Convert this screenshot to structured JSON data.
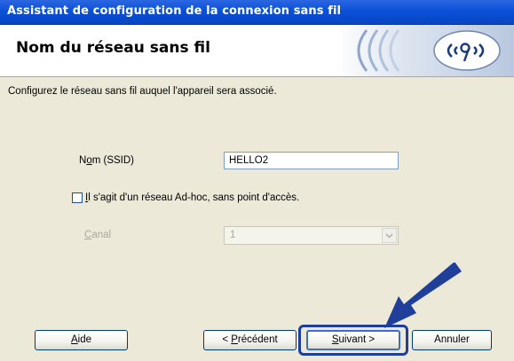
{
  "window": {
    "title": "Assistant de configuration de la connexion sans fil"
  },
  "header": {
    "title": "Nom du réseau sans fil",
    "logo_icon": "wireless-signal-icon"
  },
  "description": "Configurez le réseau sans fil auquel l'appareil sera associé.",
  "form": {
    "ssid_label_pre": "N",
    "ssid_label_key": "o",
    "ssid_label_post": "m (SSID)",
    "ssid_value": "HELLO2",
    "adhoc_checked": false,
    "adhoc_label_key": "I",
    "adhoc_label_rest": "l s'agit d'un réseau Ad-hoc, sans point d'accès.",
    "channel_label_key": "C",
    "channel_label_rest": "anal",
    "channel_value": "1"
  },
  "buttons": {
    "help_key": "A",
    "help_rest": "ide",
    "prev_pre": "< ",
    "prev_key": "P",
    "prev_rest": "récédent",
    "next_key": "S",
    "next_rest": "uivant >",
    "cancel": "Annuler"
  },
  "colors": {
    "titlebar": "#0a50d8",
    "highlight": "#1f3f9a",
    "arrow": "#1f3f9a"
  }
}
